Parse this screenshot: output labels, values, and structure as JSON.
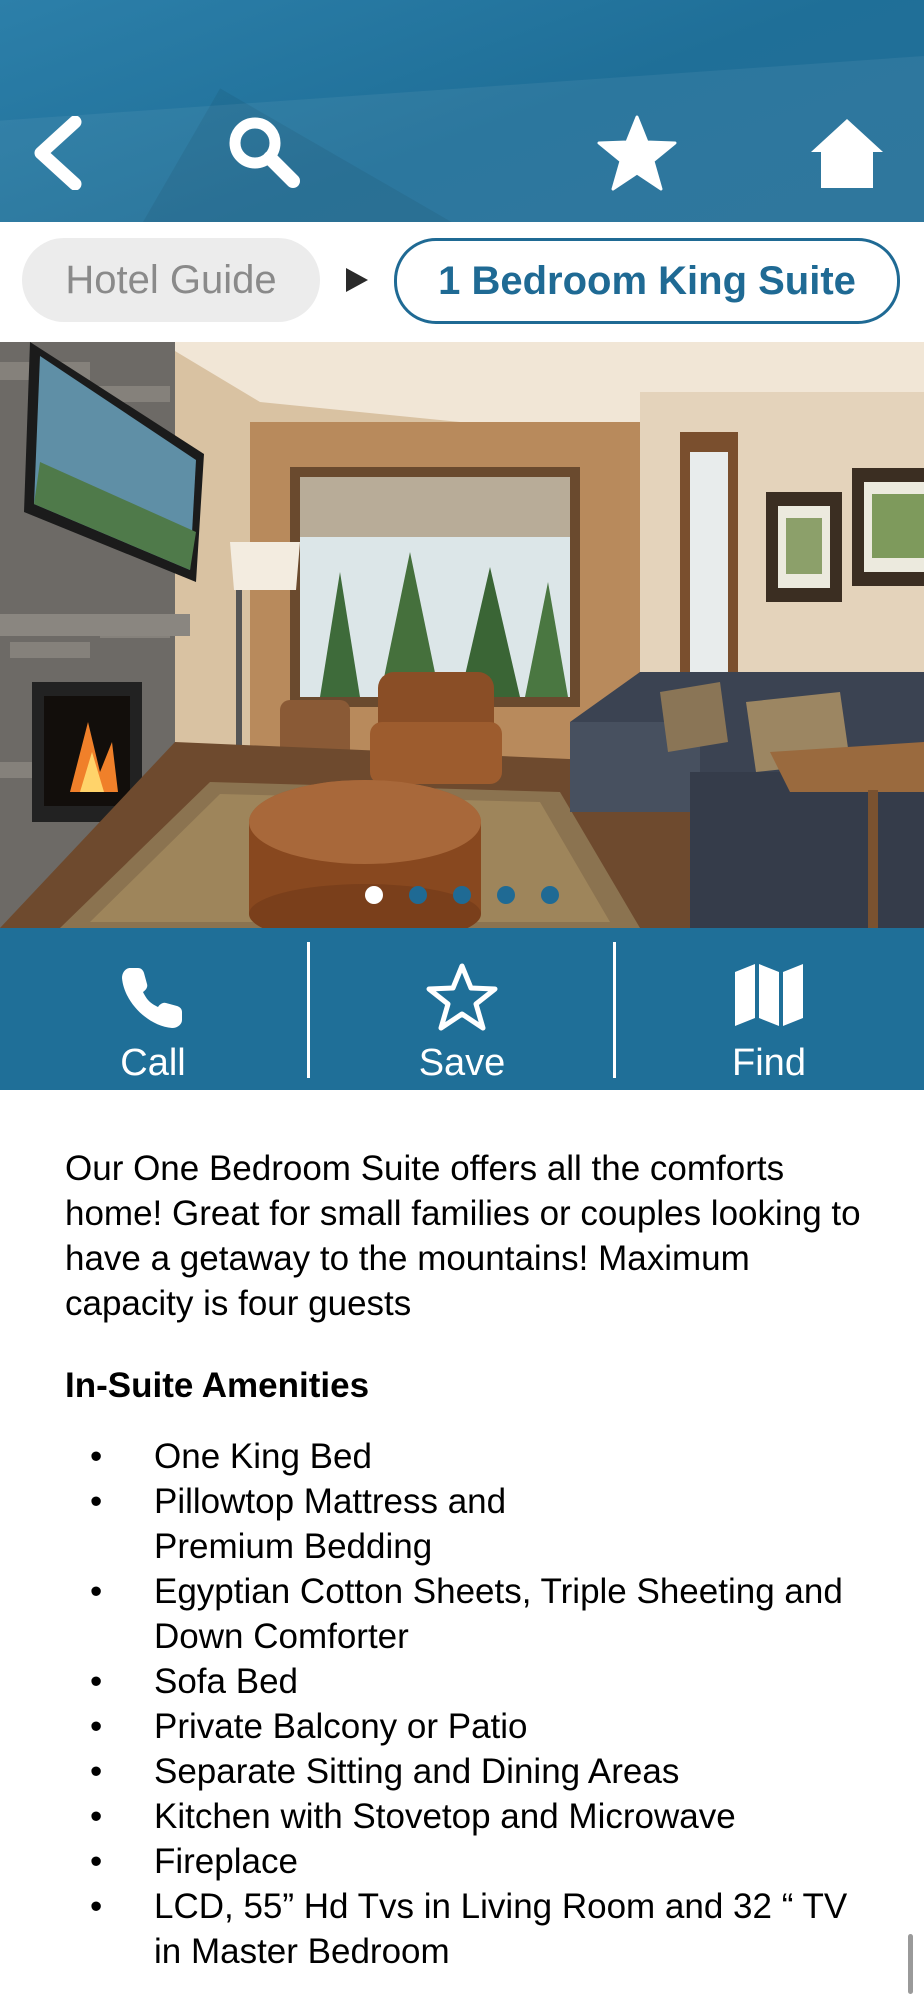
{
  "header": {
    "back_icon": "chevron-left-icon",
    "search_icon": "search-icon",
    "favorites_icon": "star-icon",
    "home_icon": "home-icon"
  },
  "breadcrumb": {
    "parent": "Hotel Guide",
    "current": "1 Bedroom King Suite"
  },
  "carousel": {
    "slide_count": 5,
    "active_index": 0
  },
  "actions": [
    {
      "label": "Call",
      "icon": "phone-icon"
    },
    {
      "label": "Save",
      "icon": "star-outline-icon"
    },
    {
      "label": "Find",
      "icon": "map-icon"
    }
  ],
  "description": {
    "intro": "Our One Bedroom Suite offers all the comforts home! Great for small families or couples looking to have a getaway to the mountains! Maximum capacity is four guests",
    "amenities_title": "In-Suite Amenities",
    "amenities": [
      "One King Bed",
      "Pillowtop Mattress and\nPremium Bedding",
      "Egyptian Cotton Sheets, Triple Sheeting and Down Comforter",
      "Sofa Bed",
      "Private Balcony or Patio",
      "Separate Sitting and Dining Areas",
      "Kitchen with Stovetop and Microwave",
      "Fireplace",
      "LCD, 55” Hd Tvs in Living Room and 32 “ TV in Master Bedroom"
    ]
  },
  "colors": {
    "brand_blue": "#1f6f98",
    "crumb_gray": "#ececec",
    "white": "#ffffff"
  }
}
